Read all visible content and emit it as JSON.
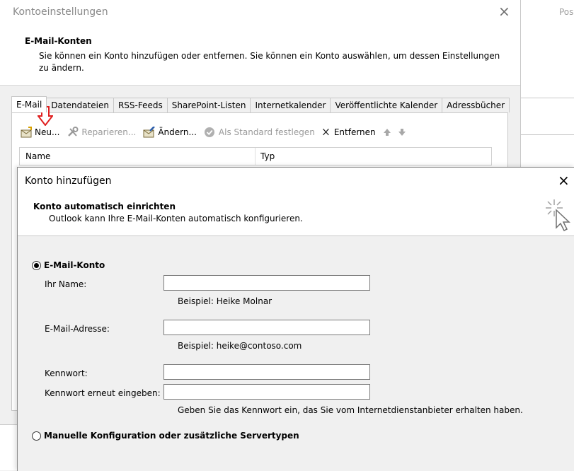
{
  "background_app": {
    "text": "Pos"
  },
  "outer_dialog": {
    "title": "Kontoeinstellungen",
    "close_glyph": "×",
    "heading": "E-Mail-Konten",
    "description": "Sie können ein Konto hinzufügen oder entfernen. Sie können ein Konto auswählen, um dessen Einstellungen zu ändern.",
    "tabs": [
      {
        "label": "E-Mail",
        "active": true
      },
      {
        "label": "Datendateien"
      },
      {
        "label": "RSS-Feeds"
      },
      {
        "label": "SharePoint-Listen"
      },
      {
        "label": "Internetkalender"
      },
      {
        "label": "Veröffentlichte Kalender"
      },
      {
        "label": "Adressbücher"
      }
    ],
    "toolbar": {
      "new": "Neu...",
      "repair": "Reparieren...",
      "change": "Ändern...",
      "set_default": "Als Standard festlegen",
      "remove": "Entfernen"
    },
    "list_columns": {
      "name": "Name",
      "type": "Typ"
    }
  },
  "inner_dialog": {
    "title": "Konto hinzufügen",
    "close_glyph": "×",
    "heading": "Konto automatisch einrichten",
    "description": "Outlook kann Ihre E-Mail-Konten automatisch konfigurieren.",
    "email_account_option": "E-Mail-Konto",
    "name_label": "Ihr Name:",
    "name_value": "",
    "name_hint": "Beispiel: Heike Molnar",
    "email_label": "E-Mail-Adresse:",
    "email_value": "",
    "email_hint": "Beispiel: heike@contoso.com",
    "password_label": "Kennwort:",
    "password_value": "",
    "password_repeat_label": "Kennwort erneut eingeben:",
    "password_repeat_value": "",
    "password_hint": "Geben Sie das Kennwort ein, das Sie vom Internetdienstanbieter erhalten haben.",
    "manual_option": "Manuelle Konfiguration oder zusätzliche Servertypen"
  },
  "colors": {
    "arrow_marker": "#e02020",
    "taskbar_blue": "#1e6fc5"
  },
  "icons": {
    "new": "new-account-icon",
    "repair": "repair-tools-icon",
    "change": "change-account-icon",
    "set_default": "checkmark-circle-icon",
    "remove": "close-x-icon",
    "move_up": "arrow-up-icon",
    "move_down": "arrow-down-icon",
    "wizard": "magic-cursor-icon"
  }
}
